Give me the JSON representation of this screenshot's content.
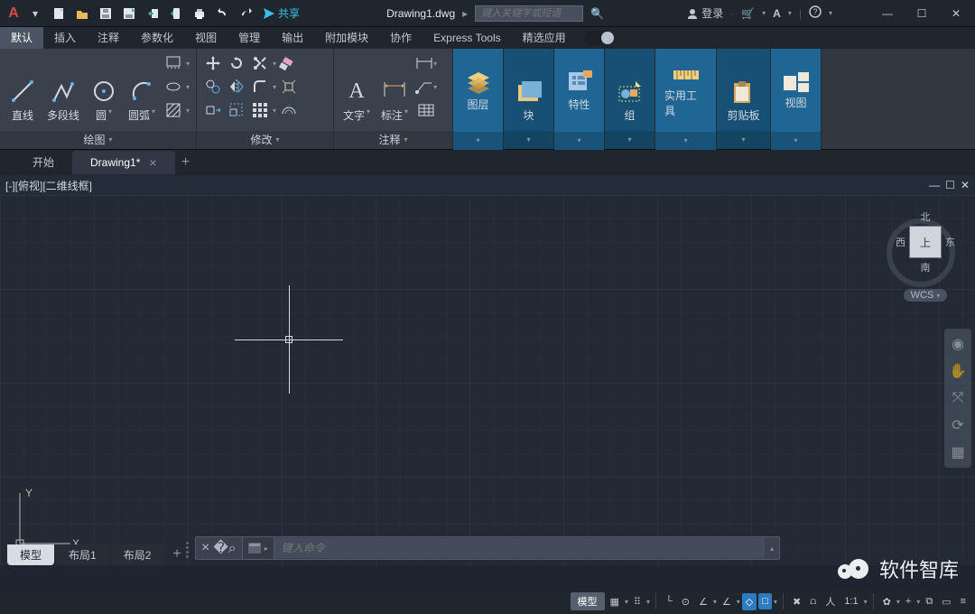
{
  "title": {
    "doc": "Drawing1.dwg",
    "search_placeholder": "键入关键字或短语",
    "share": "共享",
    "login": "登录"
  },
  "ribbon_tabs": [
    "默认",
    "插入",
    "注释",
    "参数化",
    "视图",
    "管理",
    "输出",
    "附加模块",
    "协作",
    "Express Tools",
    "精选应用"
  ],
  "panels": {
    "draw": {
      "title": "绘图",
      "line": "直线",
      "pline": "多段线",
      "circle": "圆",
      "arc": "圆弧"
    },
    "modify": {
      "title": "修改"
    },
    "annot": {
      "title": "注释",
      "text": "文字",
      "dim": "标注"
    },
    "layer": {
      "title": "图层"
    },
    "block": {
      "title": "块"
    },
    "prop": {
      "title": "特性"
    },
    "group": {
      "title": "组"
    },
    "util": {
      "title": "实用工具"
    },
    "clip": {
      "title": "剪贴板"
    },
    "view": {
      "title": "视图"
    }
  },
  "file_tabs": {
    "start": "开始",
    "doc": "Drawing1*"
  },
  "viewport": {
    "label": "[-][俯视][二维线框]"
  },
  "viewcube": {
    "n": "北",
    "s": "南",
    "e": "东",
    "w": "西",
    "top": "上",
    "wcs": "WCS"
  },
  "cmd": {
    "placeholder": "键入命令"
  },
  "layout_tabs": {
    "model": "模型",
    "l1": "布局1",
    "l2": "布局2"
  },
  "status": {
    "model": "模型",
    "scale": "1:1"
  },
  "watermark": "软件智库"
}
